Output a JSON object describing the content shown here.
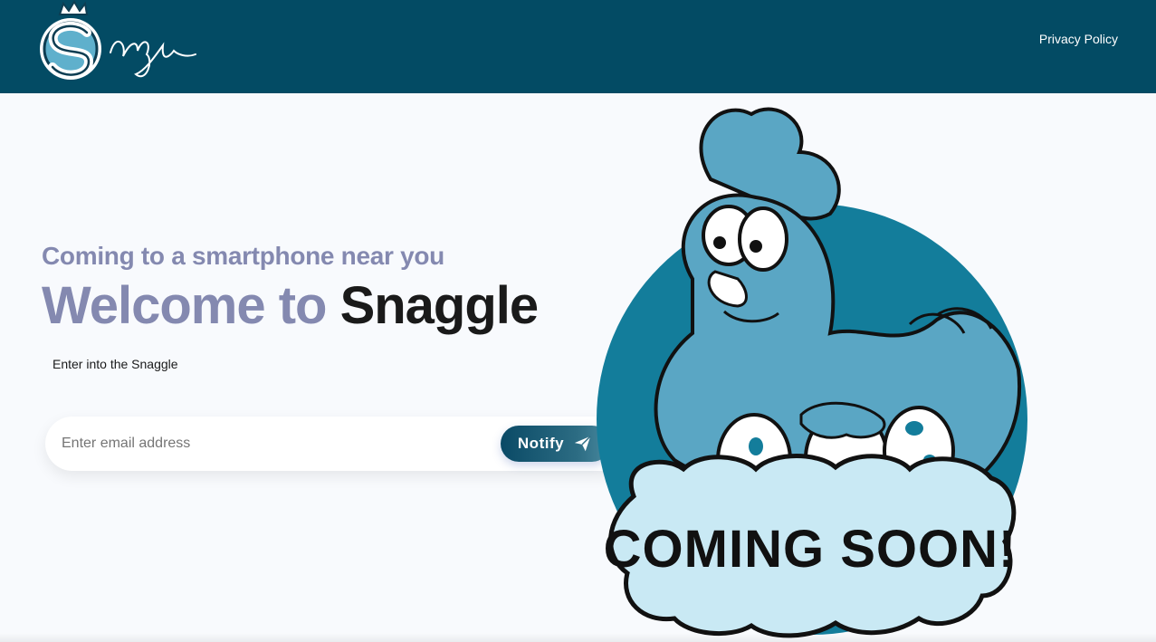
{
  "header": {
    "logo_alt": "Snaggle",
    "nav": {
      "privacy_label": "Privacy Policy"
    }
  },
  "hero": {
    "subtitle": "Coming to a smartphone near you",
    "title_prefix": "Welcome to ",
    "title_brand": "Snaggle",
    "tagline": "Enter into the Snaggle"
  },
  "form": {
    "email_placeholder": "Enter email address",
    "email_value": "",
    "notify_label": "Notify",
    "notify_icon": "paper-plane-icon"
  },
  "illustration": {
    "banner_text": "COMING SOON!",
    "character": "chicken-on-eggs"
  },
  "colors": {
    "header_bg": "#034b64",
    "muted_title": "#8489b0",
    "accent": "#0a4a66",
    "circle": "#137d9b",
    "chicken": "#5aa6c4"
  }
}
